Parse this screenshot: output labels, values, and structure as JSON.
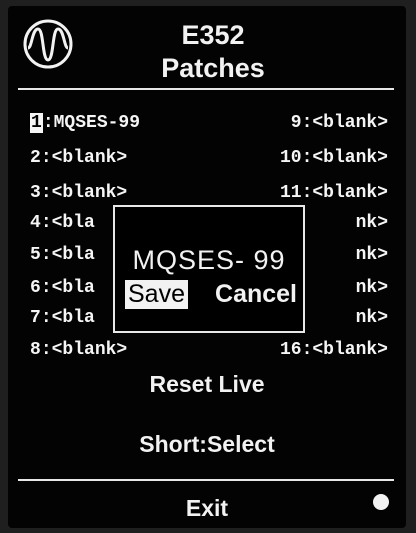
{
  "header": {
    "title": "E352",
    "subtitle": "Patches",
    "logo_icon": "sine-wave-logo"
  },
  "patches": {
    "left": [
      {
        "slot": "1",
        "name": ":MQSES-99",
        "selected": true
      },
      {
        "slot": "2",
        "name": ":<blank>"
      },
      {
        "slot": "3",
        "name": ":<blank>"
      },
      {
        "slot": "4",
        "name": ":<bla"
      },
      {
        "slot": "5",
        "name": ":<bla"
      },
      {
        "slot": "6",
        "name": ":<bla"
      },
      {
        "slot": "7",
        "name": ":<bla"
      },
      {
        "slot": "8",
        "name": ":<blank>"
      }
    ],
    "right": [
      {
        "label": "9:<blank>"
      },
      {
        "label": "10:<blank>"
      },
      {
        "label": "11:<blank>"
      },
      {
        "label": "nk>"
      },
      {
        "label": "nk>"
      },
      {
        "label": "nk>"
      },
      {
        "label": "nk>"
      },
      {
        "label": "16:<blank>"
      }
    ]
  },
  "dialog": {
    "patch_name": "MQSES- 99",
    "save_label": "Save",
    "cancel_label": "Cancel"
  },
  "menu": {
    "reset_label": "Reset Live",
    "short_label": "Short:Select",
    "exit_label": "Exit"
  },
  "colors": {
    "screen_bg": "#030303",
    "text": "#f2f2f2",
    "highlight_bg": "#f2f2f2",
    "highlight_text": "#000000"
  }
}
